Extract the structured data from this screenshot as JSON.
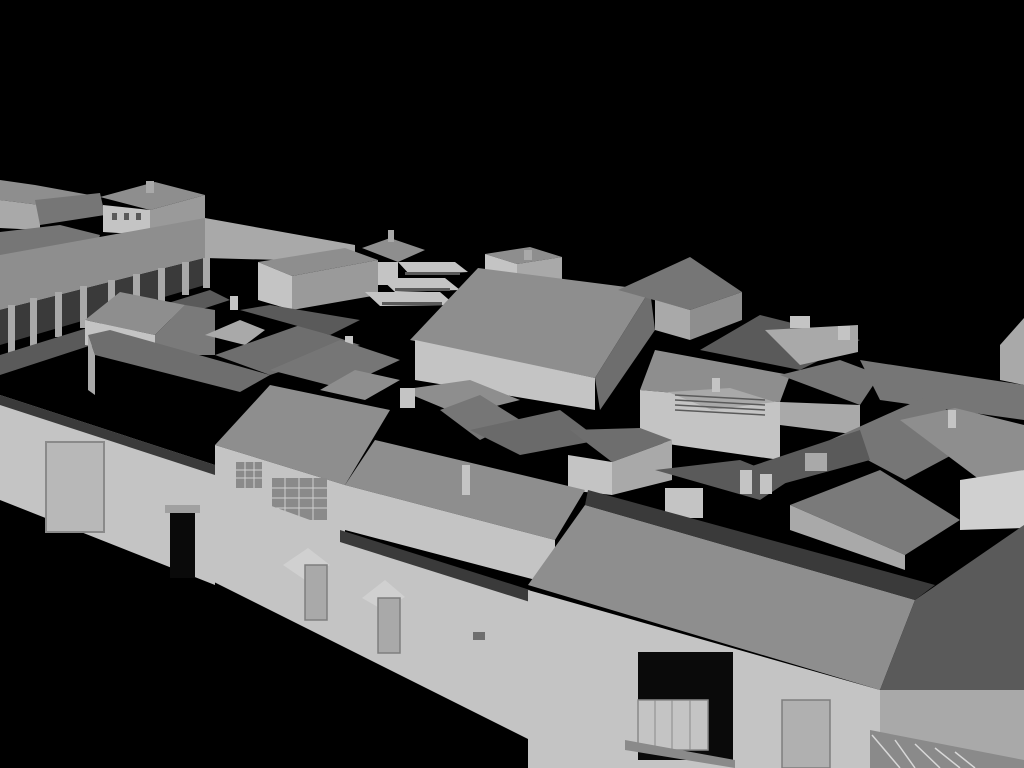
{
  "scene": {
    "background": "#000000",
    "palette": {
      "wall_light": "#c4c4c4",
      "wall_mid": "#a9a9a9",
      "wall_dark": "#7e7e7e",
      "roof_light": "#8e8e8e",
      "roof_mid": "#767676",
      "roof_dark": "#5a5a5a",
      "shadow": "#3a3a3a",
      "opening": "#0a0a0a"
    }
  }
}
